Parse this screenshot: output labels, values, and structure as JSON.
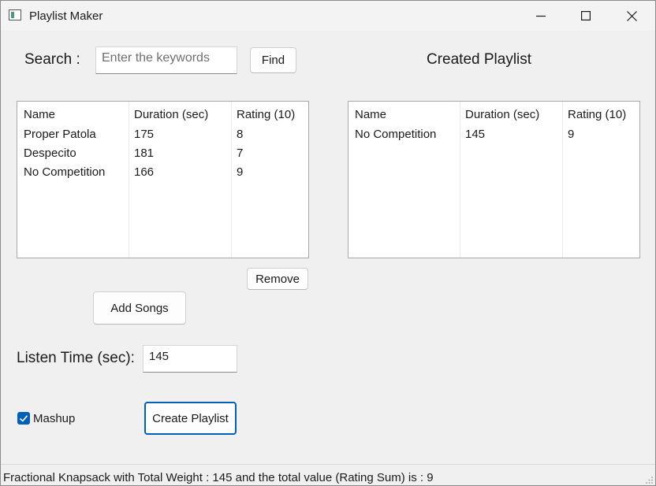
{
  "window": {
    "title": "Playlist Maker",
    "icon": "app-window-icon"
  },
  "search": {
    "label": "Search :",
    "placeholder": "Enter the keywords",
    "find_label": "Find"
  },
  "created_playlist": {
    "heading": "Created Playlist"
  },
  "songs_table": {
    "columns": [
      "Name",
      "Duration (sec)",
      "Rating  (10)"
    ],
    "rows": [
      [
        "Proper Patola",
        "175",
        "8"
      ],
      [
        "Despecito",
        "181",
        "7"
      ],
      [
        "No Competition",
        "166",
        "9"
      ]
    ]
  },
  "playlist_table": {
    "columns": [
      "Name",
      "Duration (sec)",
      "Rating  (10)"
    ],
    "rows": [
      [
        "No Competition",
        "145",
        "9"
      ]
    ]
  },
  "buttons": {
    "remove": "Remove",
    "add_songs": "Add Songs",
    "create_playlist": "Create Playlist"
  },
  "listen_time": {
    "label": "Listen Time (sec):",
    "value": "145"
  },
  "mashup": {
    "label": "Mashup",
    "checked": true
  },
  "status": {
    "text": "Fractional Knapsack with Total Weight : 145  and the total value (Rating Sum) is : 9"
  },
  "colors": {
    "accent": "#005fb8",
    "window_bg": "#f0f0f0"
  }
}
